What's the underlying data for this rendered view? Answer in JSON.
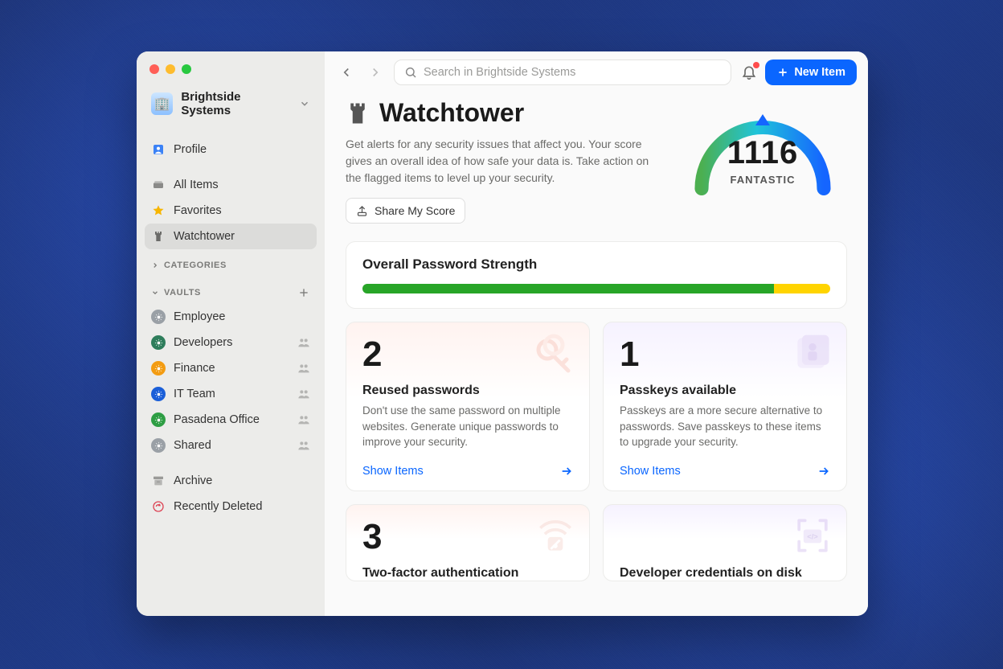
{
  "account": {
    "name": "Brightside Systems"
  },
  "sidebar": {
    "profile": "Profile",
    "items": {
      "all": "All Items",
      "fav": "Favorites",
      "watch": "Watchtower"
    },
    "sections": {
      "categories": "CATEGORIES",
      "vaults": "VAULTS"
    },
    "vaults": [
      {
        "label": "Employee",
        "shared": false,
        "color": "#9aa0a6"
      },
      {
        "label": "Developers",
        "shared": true,
        "color": "#2e7d5b"
      },
      {
        "label": "Finance",
        "shared": true,
        "color": "#f39c12"
      },
      {
        "label": "IT Team",
        "shared": true,
        "color": "#1b5fd8"
      },
      {
        "label": "Pasadena Office",
        "shared": true,
        "color": "#2e9e44"
      },
      {
        "label": "Shared",
        "shared": true,
        "color": "#9aa0a6"
      }
    ],
    "archive": "Archive",
    "deleted": "Recently Deleted"
  },
  "topbar": {
    "search_placeholder": "Search in Brightside Systems",
    "new_item": "New Item"
  },
  "watchtower": {
    "title": "Watchtower",
    "description": "Get alerts for any security issues that affect you. Your score gives an overall idea of how safe your data is. Take action on the flagged items to level up your security.",
    "share": "Share My Score",
    "score": "1116",
    "score_label": "FANTASTIC"
  },
  "strength": {
    "title": "Overall Password Strength",
    "green_pct": 88,
    "yellow_pct": 12
  },
  "cards": [
    {
      "count": "2",
      "title": "Reused passwords",
      "desc": "Don't use the same password on multiple websites. Generate unique passwords to improve your security.",
      "link": "Show Items"
    },
    {
      "count": "1",
      "title": "Passkeys available",
      "desc": "Passkeys are a more secure alternative to passwords. Save passkeys to these items to upgrade your security.",
      "link": "Show Items"
    },
    {
      "count": "3",
      "title": "Two-factor authentication",
      "desc": "",
      "link": ""
    },
    {
      "count": "",
      "title": "Developer credentials on disk",
      "desc": "",
      "link": ""
    }
  ]
}
